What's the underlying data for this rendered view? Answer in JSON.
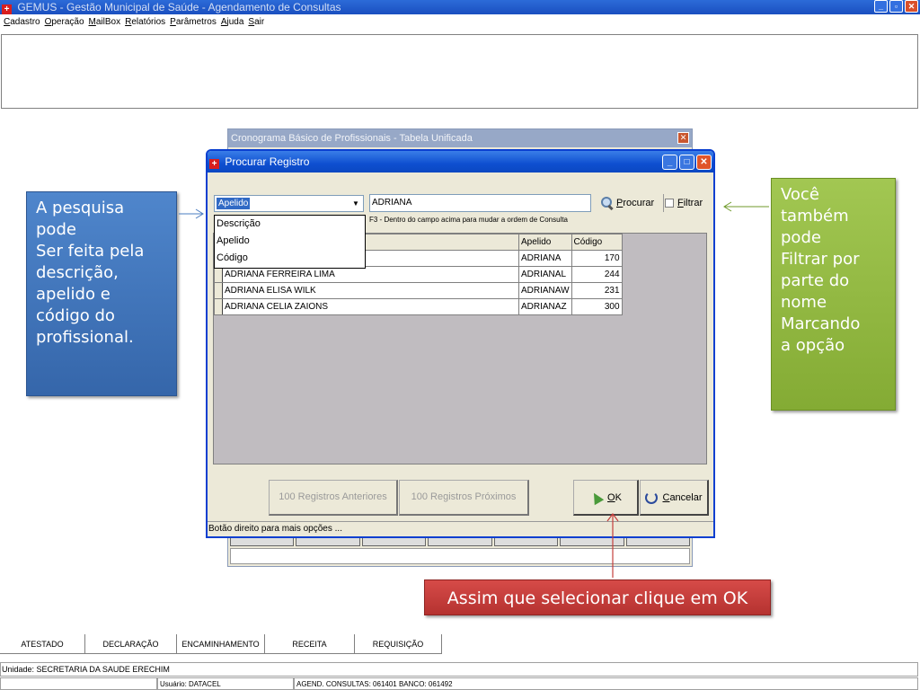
{
  "main_window": {
    "title": "GEMUS - Gestão Municipal de Saúde - Agendamento de Consultas",
    "menu": [
      "Cadastro",
      "Operação",
      "MailBox",
      "Relatórios",
      "Parâmetros",
      "Ajuda",
      "Sair"
    ]
  },
  "background_window": {
    "title": "Cronograma Básico de Profissionais - Tabela Unificada"
  },
  "dialog": {
    "title": "Procurar Registro",
    "search_type_value": "Apelido",
    "search_type_options": [
      "Descrição",
      "Apelido",
      "Código"
    ],
    "search_value": "ADRIANA",
    "hint": "F3 - Dentro do campo acima para mudar a ordem de Consulta",
    "procurar_label": "Procurar",
    "filtrar_label": "Filtrar",
    "grid": {
      "headers": {
        "descricao": "",
        "apelido": "Apelido",
        "codigo": "Código"
      },
      "rows": [
        {
          "descricao": "",
          "apelido": "ADRIANA",
          "codigo": "170"
        },
        {
          "descricao": "ADRIANA FERREIRA LIMA",
          "apelido": "ADRIANAL",
          "codigo": "244"
        },
        {
          "descricao": "ADRIANA ELISA WILK",
          "apelido": "ADRIANAW",
          "codigo": "231"
        },
        {
          "descricao": "ADRIANA CELIA ZAIONS",
          "apelido": "ADRIANAZ",
          "codigo": "300"
        }
      ]
    },
    "btn_anteriores": "100 Registros Anteriores",
    "btn_proximos": "100 Registros Próximos",
    "btn_ok": "OK",
    "btn_cancelar": "Cancelar",
    "status_text": "Botão direito para mais opções ..."
  },
  "callouts": {
    "left_lines": [
      "A pesquisa",
      "pode",
      "Ser feita pela",
      "descrição,",
      "apelido e",
      "código do",
      "profissional."
    ],
    "right_lines": [
      "Você",
      "também",
      "pode",
      "Filtrar por",
      "parte do",
      "nome",
      "Marcando",
      "a opção"
    ],
    "bottom": "Assim que selecionar clique em OK"
  },
  "bottom_tabs": [
    "ATESTADO",
    "DECLARAÇÃO",
    "ENCAMINHAMENTO",
    "RECEITA",
    "REQUISIÇÃO"
  ],
  "status_bar": {
    "unidade": "Unidade: SECRETARIA DA SAUDE ERECHIM",
    "usuario": "Usuário: DATACEL",
    "agend": "AGEND. CONSULTAS: 061401 BANCO: 061492"
  },
  "colors": {
    "callout_left": "#3f76bd",
    "callout_right": "#92b843",
    "callout_bottom": "#c43e3c",
    "dialog_title": "#0e4fd0"
  }
}
